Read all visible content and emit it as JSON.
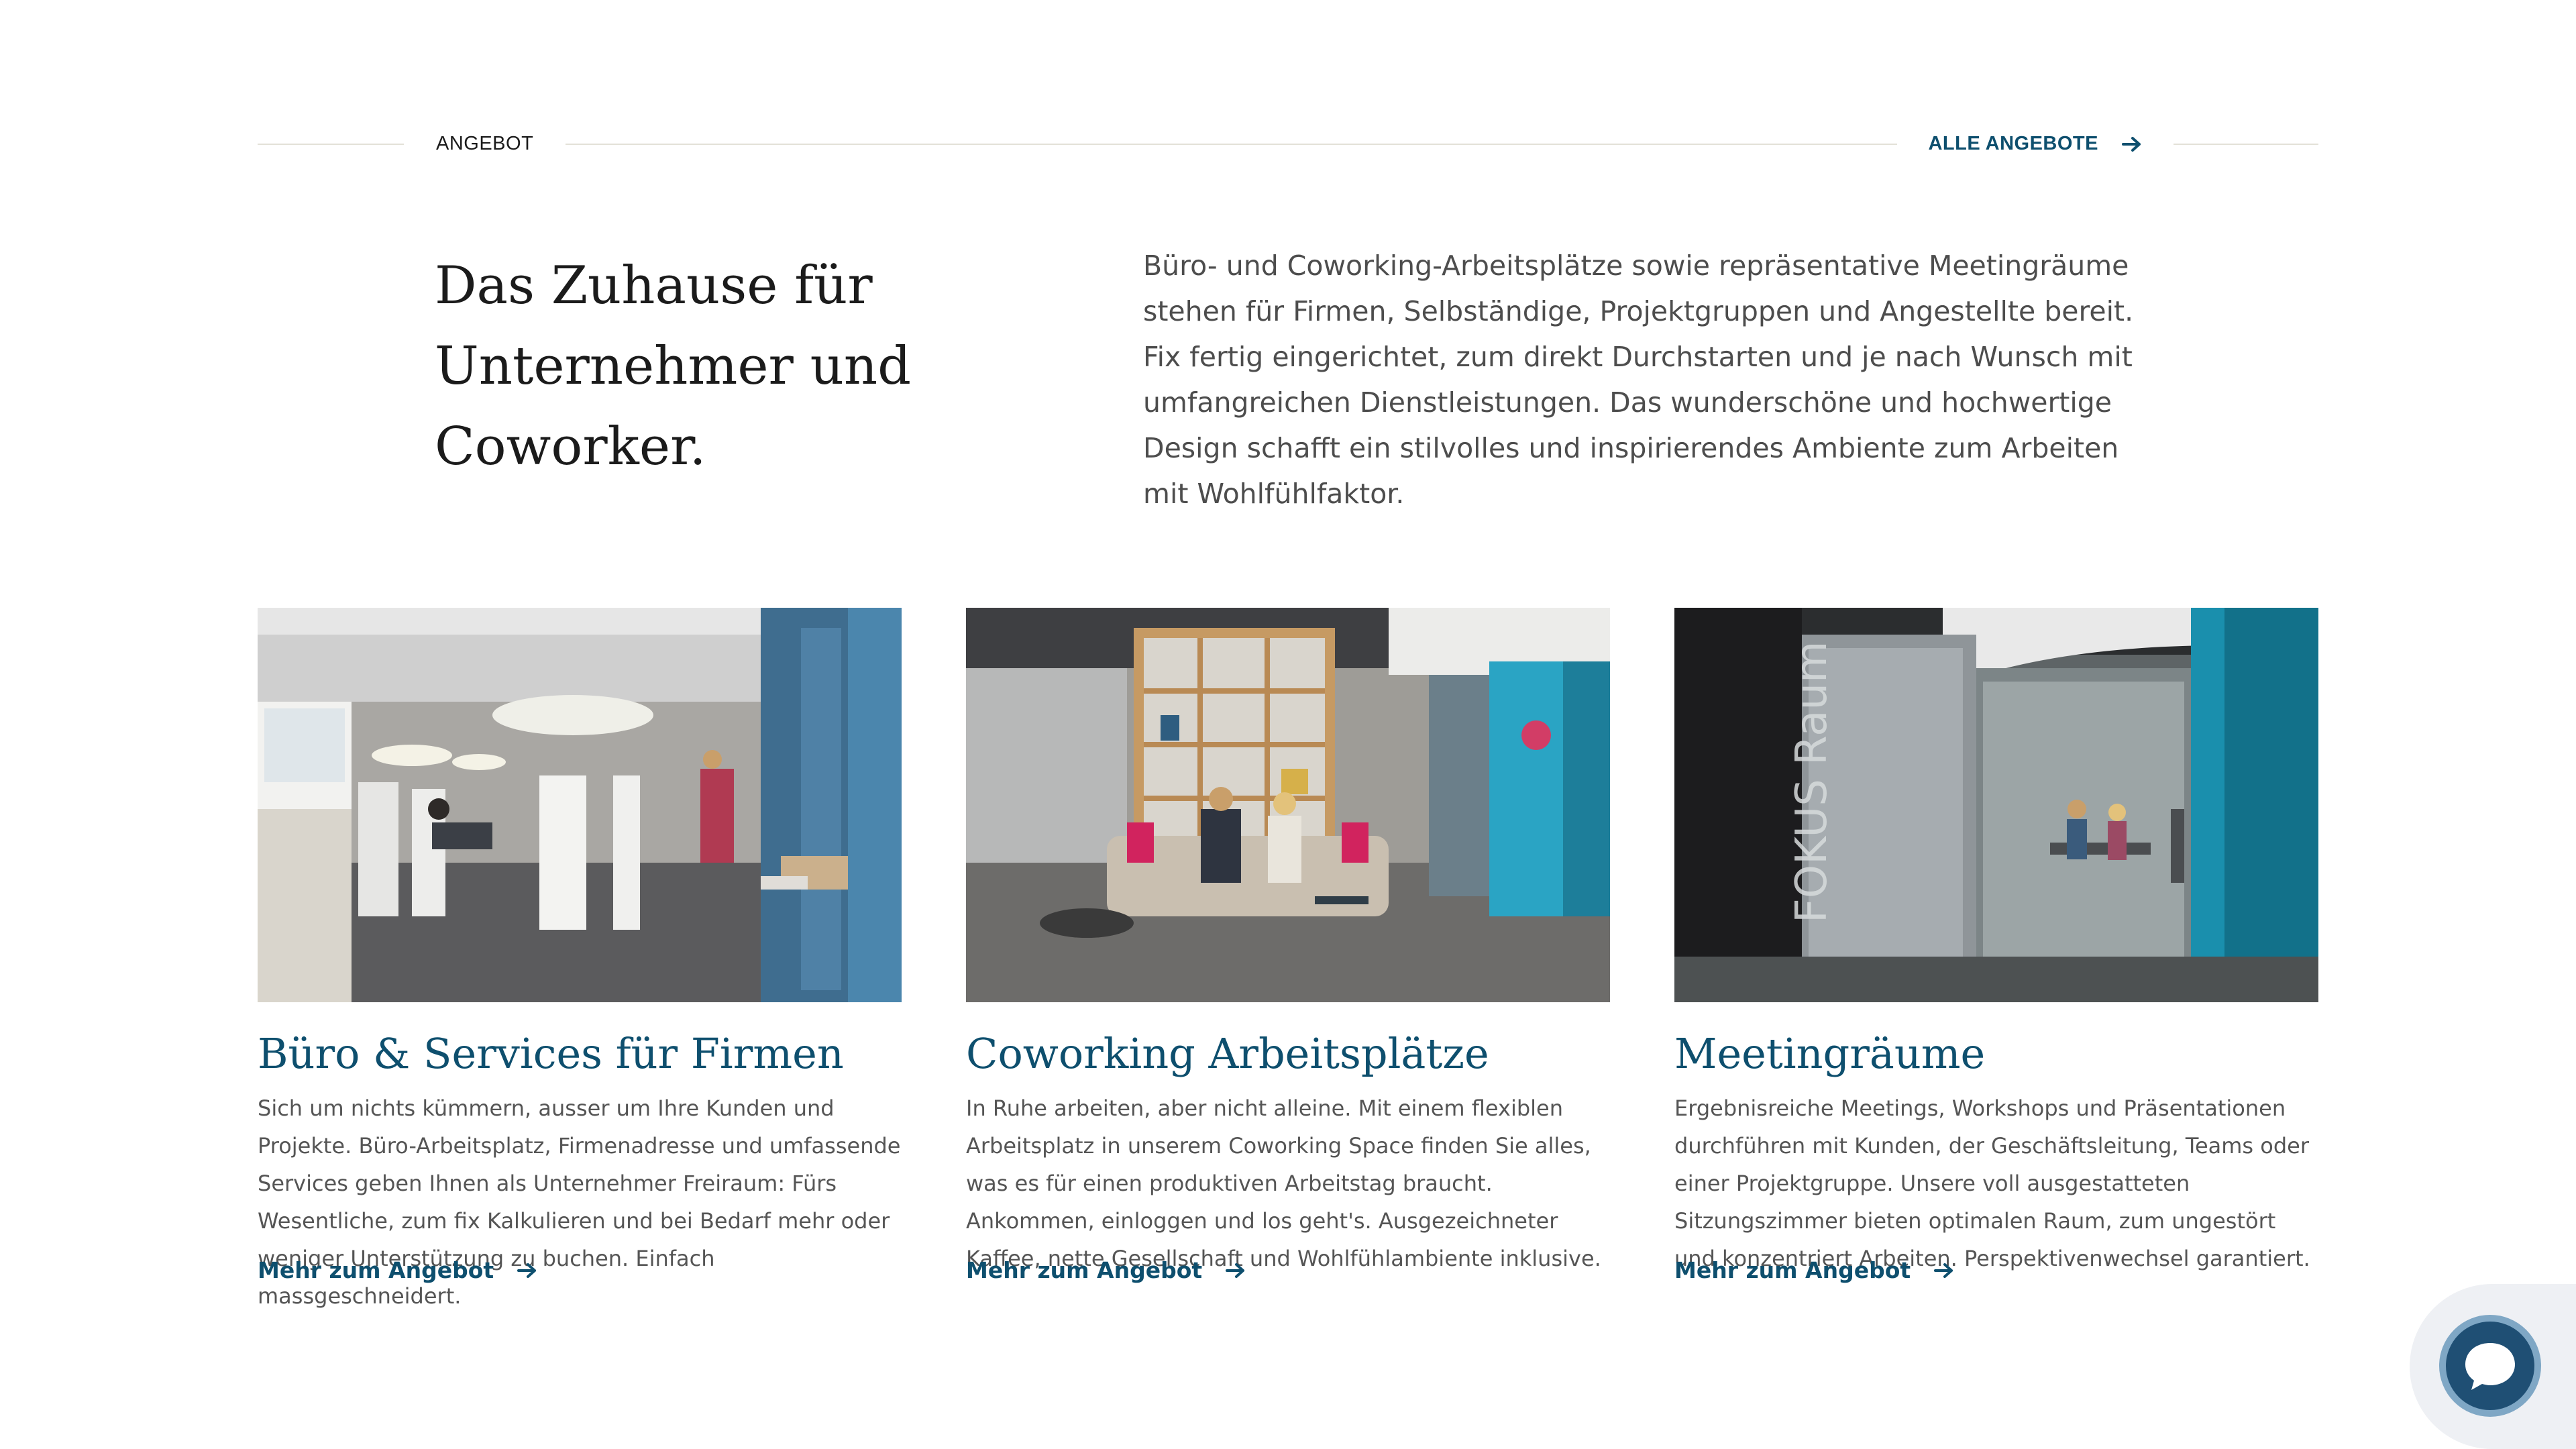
{
  "section": {
    "label": "ANGEBOT",
    "all_offers_label": "ALLE ANGEBOTE"
  },
  "intro": {
    "title": "Das Zuhause für\nUnternehmer und\nCoworker.",
    "text": "Büro- und Coworking-Arbeitsplätze sowie repräsentative Meetingräume stehen für Firmen, Selbständige, Projektgruppen und Angestellte bereit. Fix fertig eingerichtet, zum direkt Durchstarten und je nach Wunsch mit umfangreichen Dienstleistungen. Das wunderschöne und hochwertige Design schafft ein stilvolles und inspirierendes Ambiente zum Arbeiten mit Wohlfühlfaktor."
  },
  "cards": [
    {
      "title": "Büro & Services für Firmen",
      "text": "Sich um nichts kümmern, ausser um Ihre Kunden und Projekte. Büro-Arbeitsplatz, Firmenadresse und umfassende Services geben Ihnen als Unternehmer Freiraum: Fürs Wesentliche, zum fix Kalkulieren und bei Bedarf mehr oder weniger Unterstützung zu buchen. Einfach massgeschneidert.",
      "link": "Mehr zum Angebot"
    },
    {
      "title": "Coworking Arbeitsplätze",
      "text": "In Ruhe arbeiten, aber nicht alleine. Mit einem flexiblen Arbeitsplatz in unserem Coworking Space finden Sie alles, was es für einen produktiven Arbeitstag braucht. Ankommen, einloggen und los geht's. Ausgezeichneter Kaffee, nette Gesellschaft und Wohlfühlambiente inklusive.",
      "link": "Mehr zum Angebot"
    },
    {
      "title": "Meetingräume",
      "text": "Ergebnisreiche Meetings, Workshops und Präsentationen durchführen mit Kunden, der Geschäftsleitung, Teams oder einer Projektgruppe. Unsere voll ausgestatteten Sitzungszimmer bieten optimalen Raum, zum ungestört und konzentriert Arbeiten. Perspektivenwechsel garantiert.",
      "link": "Mehr zum Angebot",
      "photo_sign": "FOKUS Raum"
    }
  ],
  "colors": {
    "accent": "#0e4f6e",
    "chat_button": "#1f4f74",
    "chat_ring": "#7fa7c5",
    "rule": "#e3e1d8"
  },
  "icons": {
    "arrow": "arrow-right-icon",
    "chat": "chat-bubble-icon"
  }
}
